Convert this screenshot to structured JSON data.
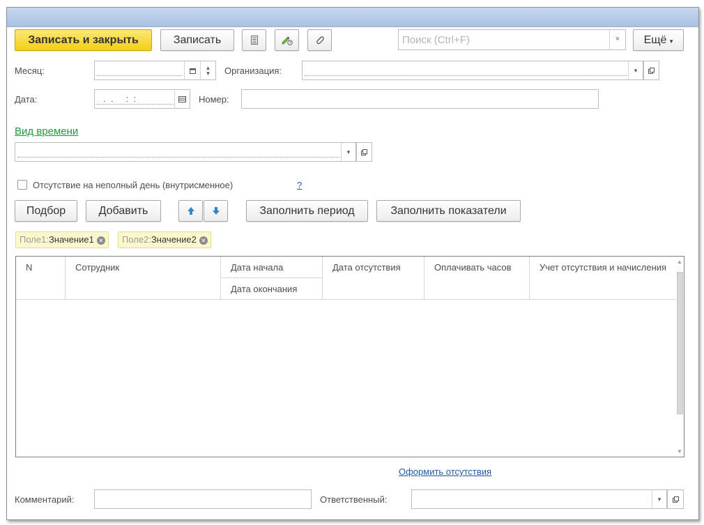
{
  "toolbar": {
    "save_close_label": "Записать и закрыть",
    "save_label": "Записать",
    "search_placeholder": "Поиск (Ctrl+F)",
    "search_clear": "×",
    "more_label": "Ещё",
    "more_arrow": "▾"
  },
  "fields": {
    "month_label": "Месяц:",
    "month_value": "",
    "organization_label": "Организация:",
    "organization_value": "",
    "date_label": "Дата:",
    "date_value": ".  .     :  :",
    "number_label": "Номер:",
    "number_value": "",
    "time_type_link": "Вид времени",
    "time_type_value": "",
    "partial_day_label": "Отсутствие на неполный день (внутрисменное)",
    "help_link": "?"
  },
  "actions": {
    "pick_label": "Подбор",
    "add_label": "Добавить",
    "fill_period_label": "Заполнить период",
    "fill_indicators_label": "Заполнить показатели"
  },
  "filters": [
    {
      "key": "Поле1:",
      "value": "Значение1"
    },
    {
      "key": "Поле2:",
      "value": "Значение2"
    }
  ],
  "table": {
    "columns": {
      "n": "N",
      "employee": "Сотрудник",
      "start_date": "Дата начала",
      "end_date": "Дата окончания",
      "absence_date": "Дата отсутствия",
      "pay_hours": "Оплачивать часов",
      "accounting": "Учет отсутствия и начисления"
    },
    "rows": []
  },
  "footer": {
    "register_link": "Оформить отсутствия",
    "comment_label": "Комментарий:",
    "comment_value": "",
    "responsible_label": "Ответственный:",
    "responsible_value": ""
  },
  "colors": {
    "accent_button": "#f3cf12",
    "title_bar": "#b5cbe8",
    "link": "#1e5aa8",
    "green_link": "#1e9a3c",
    "arrow_icon": "#2f86c9"
  }
}
